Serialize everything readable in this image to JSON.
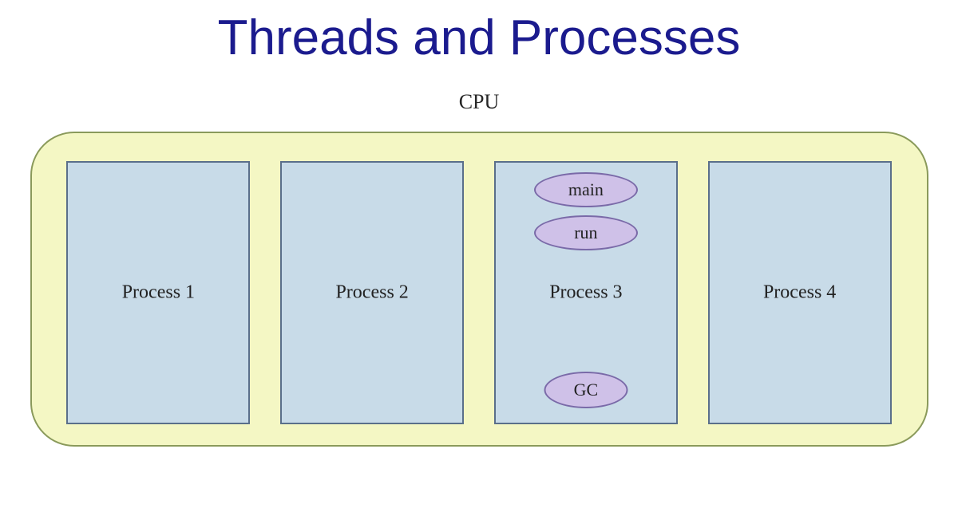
{
  "title": "Threads and Processes",
  "cpu_label": "CPU",
  "processes": [
    {
      "label": "Process 1"
    },
    {
      "label": "Process 2"
    },
    {
      "label": "Process 3"
    },
    {
      "label": "Process 4"
    }
  ],
  "threads": {
    "main": "main",
    "run": "run",
    "gc": "GC"
  }
}
